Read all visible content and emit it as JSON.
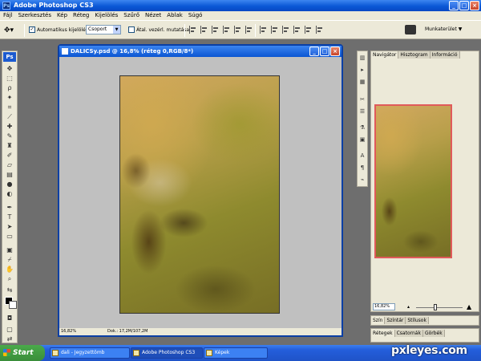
{
  "window": {
    "title": "Adobe Photoshop CS3",
    "app_icon": "Ps"
  },
  "menu": [
    "Fájl",
    "Szerkesztés",
    "Kép",
    "Réteg",
    "Kijelölés",
    "Szűrő",
    "Nézet",
    "Ablak",
    "Súgó"
  ],
  "options": {
    "auto_select_checked": "✓",
    "auto_select_label": "Automatikus kijelölés:",
    "group_value": "Csoport",
    "show_transform_label": "Átal. vezérl. mutatása",
    "workspace_label": "Munkaterület ▼"
  },
  "toolbox": {
    "logo": "Ps"
  },
  "document": {
    "title": "DALICSy.psd @ 16,8% (réteg 0,RGB/8*)",
    "zoom": "16,82%",
    "doc_info": "Dok.: 17,2M/107,2M"
  },
  "navigator": {
    "tabs": [
      "Navigátor",
      "Hisztogram",
      "Információ"
    ],
    "zoom": "16,82%"
  },
  "panel2": {
    "tabs": [
      "Szín",
      "Színtár",
      "Stílusok"
    ]
  },
  "panel3": {
    "tabs": [
      "Rétegek",
      "Csatornák",
      "Görbék"
    ]
  },
  "taskbar": {
    "start": "Start",
    "items": [
      "dali - Jegyzettömb",
      "Adobe Photoshop CS3",
      "Képek"
    ]
  },
  "watermark": "pxleyes.com",
  "icons": {
    "minimize": "minimize-icon",
    "maximize": "maximize-icon",
    "close": "close-icon"
  }
}
